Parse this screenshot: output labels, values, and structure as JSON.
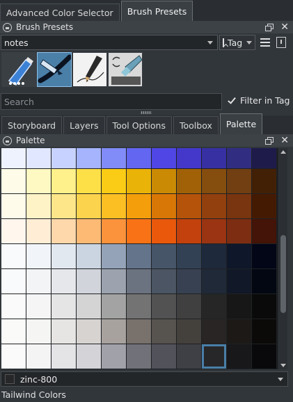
{
  "top_tabs": [
    {
      "label": "Advanced Color Selector",
      "active": false
    },
    {
      "label": "Brush Presets",
      "active": true
    }
  ],
  "brush_presets": {
    "title": "Brush Presets",
    "tag_combo_value": "notes",
    "tag_button_label": "Tag",
    "presets": [
      {
        "icon": "eraser-brush-icon",
        "selected": false
      },
      {
        "icon": "ink-pen-brush-icon",
        "selected": true
      },
      {
        "icon": "pencil-brush-icon",
        "selected": false
      },
      {
        "icon": "marker-brush-icon",
        "selected": false
      }
    ],
    "search_placeholder": "Search",
    "filter_label": "Filter in Tag",
    "filter_checked": true
  },
  "bottom_tabs": [
    {
      "label": "Storyboard",
      "active": false
    },
    {
      "label": "Layers",
      "active": false
    },
    {
      "label": "Tool Options",
      "active": false
    },
    {
      "label": "Toolbox",
      "active": false
    },
    {
      "label": "Palette",
      "active": true
    }
  ],
  "palette": {
    "title": "Palette",
    "rows": [
      [
        "#eef2ff",
        "#e0e7ff",
        "#c7d2fe",
        "#a5b4fc",
        "#818cf8",
        "#6366f1",
        "#4f46e5",
        "#4338ca",
        "#3730a3",
        "#312e81",
        "#1e1b4b"
      ],
      [
        "#fefce8",
        "#fef9c3",
        "#fef08a",
        "#fde047",
        "#facc15",
        "#eab308",
        "#ca8a04",
        "#a16207",
        "#854d0e",
        "#713f12",
        "#422006"
      ],
      [
        "#fffbeb",
        "#fef3c7",
        "#fde68a",
        "#fcd34d",
        "#fbbf24",
        "#f59e0b",
        "#d97706",
        "#b45309",
        "#92400e",
        "#78350f",
        "#451a03"
      ],
      [
        "#fff7ed",
        "#ffedd5",
        "#fed7aa",
        "#fdba74",
        "#fb923c",
        "#f97316",
        "#ea580c",
        "#c2410c",
        "#9a3412",
        "#7c2d12",
        "#431407"
      ],
      [
        "#f8fafc",
        "#f1f5f9",
        "#e2e8f0",
        "#cbd5e1",
        "#94a3b8",
        "#64748b",
        "#475569",
        "#334155",
        "#1e293b",
        "#0f172a",
        "#020617"
      ],
      [
        "#f9fafb",
        "#f3f4f6",
        "#e5e7eb",
        "#d1d5db",
        "#9ca3af",
        "#6b7280",
        "#4b5563",
        "#374151",
        "#1f2937",
        "#111827",
        "#030712"
      ],
      [
        "#fafafa",
        "#f5f5f5",
        "#e5e5e5",
        "#d4d4d4",
        "#a3a3a3",
        "#737373",
        "#525252",
        "#404040",
        "#262626",
        "#171717",
        "#0a0a0a"
      ],
      [
        "#fafaf9",
        "#f5f5f4",
        "#e7e5e4",
        "#d6d3d1",
        "#a8a29e",
        "#78716c",
        "#57534e",
        "#44403c",
        "#292524",
        "#1c1917",
        "#0c0a09"
      ],
      [
        "#fafafa",
        "#f4f4f5",
        "#e4e4e7",
        "#d4d4d8",
        "#a1a1aa",
        "#71717a",
        "#52525b",
        "#3f3f46",
        "#27272a",
        "#18181b",
        "#09090b"
      ]
    ],
    "selected": {
      "row": 8,
      "col": 8
    },
    "scroll_fraction": 0.62,
    "scroll_size_fraction": 0.38,
    "current_color_name": "zinc-800",
    "current_color": "#27272a",
    "palette_name": "Tailwind Colors"
  }
}
